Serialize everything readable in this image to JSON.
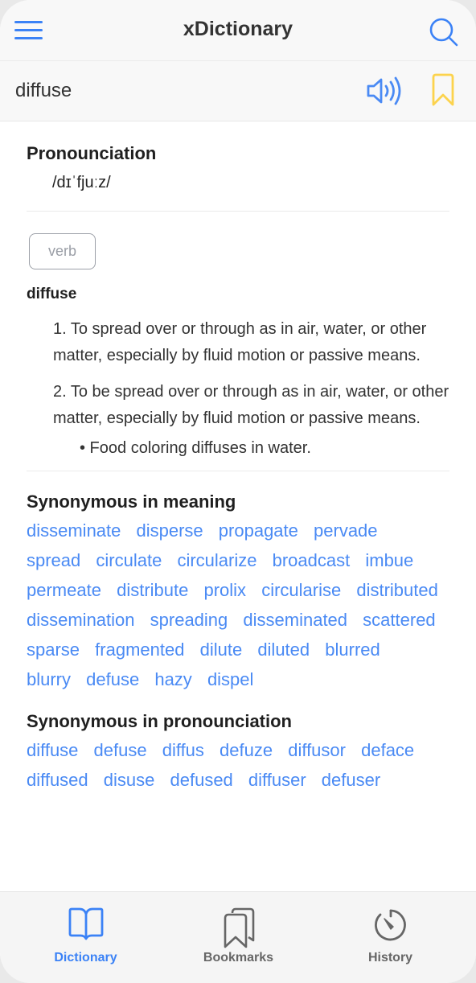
{
  "app": {
    "title": "xDictionary",
    "accent_color": "#3b82f6",
    "bookmark_color": "#fcd34d"
  },
  "header": {
    "menu_icon": "hamburger-menu-icon",
    "search_icon": "search-icon"
  },
  "word_bar": {
    "word": "diffuse",
    "speaker_icon": "speaker-icon",
    "bookmark_icon": "bookmark-outline-icon"
  },
  "pronunciation": {
    "title": "Pronounciation",
    "ipa": "/dɪˈfjuːz/"
  },
  "entry": {
    "part_of_speech": "verb",
    "word": "diffuse",
    "definitions": [
      {
        "text": "1.  To spread over or through as in air, water, or other matter, especially by fluid motion or passive means."
      },
      {
        "text": "2.  To be spread over or through as in air, water, or other matter, especially by fluid motion or passive means.",
        "example": "• Food coloring diffuses in water."
      }
    ]
  },
  "synonyms_meaning": {
    "title": "Synonymous in meaning",
    "words": [
      "disseminate",
      "disperse",
      "propagate",
      "pervade",
      "spread",
      "circulate",
      "circularize",
      "broadcast",
      "imbue",
      "permeate",
      "distribute",
      "prolix",
      "circularise",
      "distributed",
      "dissemination",
      "spreading",
      "disseminated",
      "scattered",
      "sparse",
      "fragmented",
      "dilute",
      "diluted",
      "blurred",
      "blurry",
      "defuse",
      "hazy",
      "dispel"
    ]
  },
  "synonyms_pronunciation": {
    "title": "Synonymous in pronounciation",
    "words": [
      "diffuse",
      "defuse",
      "diffus",
      "defuze",
      "diffusor",
      "deface",
      "diffused",
      "disuse",
      "defused",
      "diffuser",
      "defuser"
    ]
  },
  "bottom_nav": {
    "items": [
      {
        "label": "Dictionary",
        "icon": "open-book-icon",
        "active": true
      },
      {
        "label": "Bookmarks",
        "icon": "bookmarks-stack-icon",
        "active": false
      },
      {
        "label": "History",
        "icon": "timer-history-icon",
        "active": false
      }
    ]
  }
}
